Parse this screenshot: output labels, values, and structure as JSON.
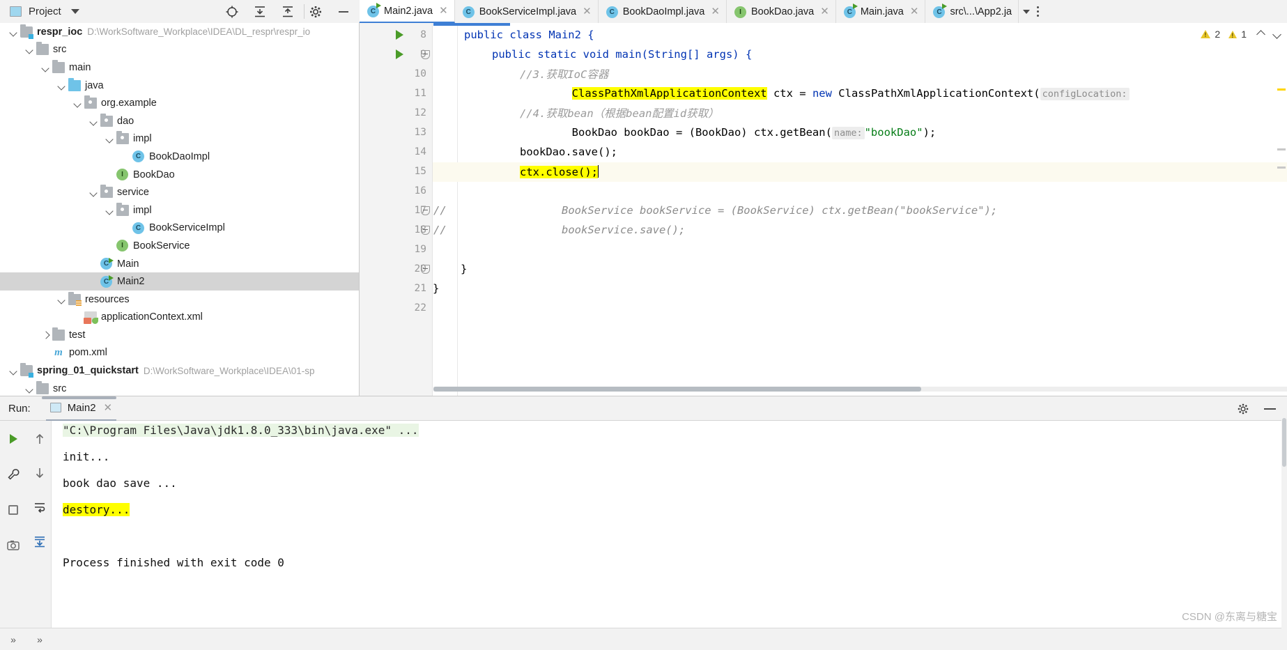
{
  "window": {
    "project_panel_title": "Project",
    "watermark": "CSDN @东离与糖宝"
  },
  "toolbar_icons": [
    "locate-icon",
    "expand-all-icon",
    "collapse-all-icon",
    "gear-icon",
    "minimize-icon"
  ],
  "project_tree": [
    {
      "label": "respr_ioc",
      "path": "D:\\WorkSoftware_Workplace\\IDEA\\DL_respr\\respr_io",
      "indent": 0,
      "arrow": "down",
      "icon": "module",
      "bold": true,
      "selected": false
    },
    {
      "label": "src",
      "path": "",
      "indent": 1,
      "arrow": "down",
      "icon": "folder",
      "bold": false,
      "selected": false
    },
    {
      "label": "main",
      "path": "",
      "indent": 2,
      "arrow": "down",
      "icon": "folder",
      "bold": false,
      "selected": false
    },
    {
      "label": "java",
      "path": "",
      "indent": 3,
      "arrow": "down",
      "icon": "folder-src",
      "bold": false,
      "selected": false
    },
    {
      "label": "org.example",
      "path": "",
      "indent": 4,
      "arrow": "down",
      "icon": "package",
      "bold": false,
      "selected": false
    },
    {
      "label": "dao",
      "path": "",
      "indent": 5,
      "arrow": "down",
      "icon": "package",
      "bold": false,
      "selected": false
    },
    {
      "label": "impl",
      "path": "",
      "indent": 6,
      "arrow": "down",
      "icon": "package",
      "bold": false,
      "selected": false
    },
    {
      "label": "BookDaoImpl",
      "path": "",
      "indent": 7,
      "arrow": "none",
      "icon": "class",
      "bold": false,
      "selected": false
    },
    {
      "label": "BookDao",
      "path": "",
      "indent": 6,
      "arrow": "none",
      "icon": "interface",
      "bold": false,
      "selected": false
    },
    {
      "label": "service",
      "path": "",
      "indent": 5,
      "arrow": "down",
      "icon": "package",
      "bold": false,
      "selected": false
    },
    {
      "label": "impl",
      "path": "",
      "indent": 6,
      "arrow": "down",
      "icon": "package",
      "bold": false,
      "selected": false
    },
    {
      "label": "BookServiceImpl",
      "path": "",
      "indent": 7,
      "arrow": "none",
      "icon": "class",
      "bold": false,
      "selected": false
    },
    {
      "label": "BookService",
      "path": "",
      "indent": 6,
      "arrow": "none",
      "icon": "interface",
      "bold": false,
      "selected": false
    },
    {
      "label": "Main",
      "path": "",
      "indent": 5,
      "arrow": "none",
      "icon": "class-run",
      "bold": false,
      "selected": false
    },
    {
      "label": "Main2",
      "path": "",
      "indent": 5,
      "arrow": "none",
      "icon": "class-run",
      "bold": false,
      "selected": true
    },
    {
      "label": "resources",
      "path": "",
      "indent": 3,
      "arrow": "down",
      "icon": "folder-res",
      "bold": false,
      "selected": false
    },
    {
      "label": "applicationContext.xml",
      "path": "",
      "indent": 4,
      "arrow": "none",
      "icon": "xml-spring",
      "bold": false,
      "selected": false
    },
    {
      "label": "test",
      "path": "",
      "indent": 2,
      "arrow": "right",
      "icon": "folder",
      "bold": false,
      "selected": false
    },
    {
      "label": "pom.xml",
      "path": "",
      "indent": 2,
      "arrow": "none",
      "icon": "maven",
      "bold": false,
      "selected": false
    },
    {
      "label": "spring_01_quickstart",
      "path": "D:\\WorkSoftware_Workplace\\IDEA\\01-sp",
      "indent": 0,
      "arrow": "down",
      "icon": "module",
      "bold": true,
      "selected": false
    },
    {
      "label": "src",
      "path": "",
      "indent": 1,
      "arrow": "down",
      "icon": "folder",
      "bold": false,
      "selected": false
    }
  ],
  "editor_tabs": [
    {
      "label": "Main2.java",
      "icon": "class-run-icon",
      "active": true,
      "closeable": true
    },
    {
      "label": "BookServiceImpl.java",
      "icon": "class-icon",
      "active": false,
      "closeable": true
    },
    {
      "label": "BookDaoImpl.java",
      "icon": "class-icon",
      "active": false,
      "closeable": true
    },
    {
      "label": "BookDao.java",
      "icon": "interface-icon",
      "active": false,
      "closeable": true
    },
    {
      "label": "Main.java",
      "icon": "class-run-icon",
      "active": false,
      "closeable": true
    },
    {
      "label": "src\\...\\App2.ja",
      "icon": "class-run-icon",
      "active": false,
      "closeable": false
    }
  ],
  "editor": {
    "inspection": {
      "warning_count": "2",
      "weak_warning_count": "1"
    },
    "lines": [
      {
        "num": "8",
        "runmark": true,
        "fold": false,
        "current": false
      },
      {
        "num": "9",
        "runmark": true,
        "fold": true,
        "current": false
      },
      {
        "num": "10",
        "runmark": false,
        "fold": false,
        "current": false
      },
      {
        "num": "11",
        "runmark": false,
        "fold": false,
        "current": false
      },
      {
        "num": "12",
        "runmark": false,
        "fold": false,
        "current": false
      },
      {
        "num": "13",
        "runmark": false,
        "fold": false,
        "current": false
      },
      {
        "num": "14",
        "runmark": false,
        "fold": false,
        "current": false
      },
      {
        "num": "15",
        "runmark": false,
        "fold": false,
        "current": true
      },
      {
        "num": "16",
        "runmark": false,
        "fold": false,
        "current": false
      },
      {
        "num": "17",
        "runmark": false,
        "fold": true,
        "current": false
      },
      {
        "num": "18",
        "runmark": false,
        "fold": true,
        "current": false
      },
      {
        "num": "19",
        "runmark": false,
        "fold": false,
        "current": false
      },
      {
        "num": "20",
        "runmark": false,
        "fold": true,
        "current": false
      },
      {
        "num": "21",
        "runmark": false,
        "fold": false,
        "current": false
      },
      {
        "num": "22",
        "runmark": false,
        "fold": false,
        "current": false
      }
    ],
    "code": {
      "l8": "public class Main2 {",
      "l9": "public static void main(String[] args) {",
      "l10": "//3.获取IoC容器",
      "l11_hl": "ClassPathXmlApplicationContext",
      "l11_mid": " ctx = ",
      "l11_new": "new",
      "l11_rest": " ClassPathXmlApplicationContext(",
      "l11_hint": "configLocation:",
      "l12": "//4.获取bean（根据bean配置id获取）",
      "l13_a": "BookDao bookDao = (BookDao) ctx.getBean(",
      "l13_hint": "name:",
      "l13_str": "\"bookDao\"",
      "l13_b": ");",
      "l14": "bookDao.save();",
      "l15_hl": "ctx.close();",
      "l17_slashes": "//",
      "l17": "BookService bookService = (BookService) ctx.getBean(\"bookService\");",
      "l18_slashes": "//",
      "l18": "bookService.save();",
      "l20": "}",
      "l21": "}"
    }
  },
  "run_panel": {
    "label": "Run:",
    "tab_name": "Main2",
    "console_lines": [
      {
        "text": "\"C:\\Program Files\\Java\\jdk1.8.0_333\\bin\\java.exe\" ...",
        "style": "command"
      },
      {
        "text": "init...",
        "style": "normal"
      },
      {
        "text": "book dao save ...",
        "style": "normal"
      },
      {
        "text": "destory...",
        "style": "highlight"
      },
      {
        "text": "",
        "style": "normal"
      },
      {
        "text": "Process finished with exit code 0",
        "style": "normal"
      }
    ],
    "side_buttons": [
      "rerun-icon",
      "scroll-up-icon",
      "wrench-icon",
      "scroll-down-icon",
      "stop-icon",
      "soft-wrap-icon",
      "camera-icon",
      "scroll-to-end-icon"
    ],
    "bottom_buttons": [
      "expand-left-icon",
      "expand-right-icon"
    ],
    "gear_icon": "gear-icon",
    "minimize_icon": "minimize-icon"
  }
}
